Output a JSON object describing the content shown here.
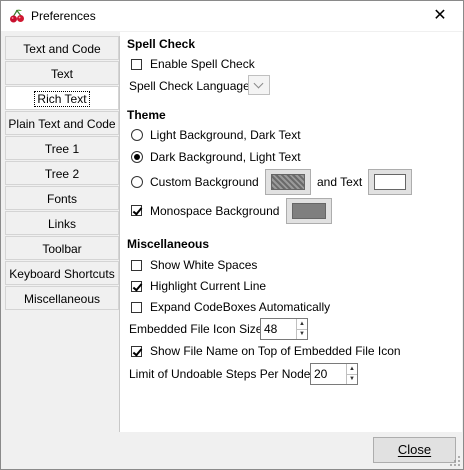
{
  "window": {
    "title": "Preferences",
    "close_glyph": "✕"
  },
  "sidebar": {
    "items": [
      {
        "label": "Text and Code"
      },
      {
        "label": "Text"
      },
      {
        "label": "Rich Text"
      },
      {
        "label": "Plain Text and Code"
      },
      {
        "label": "Tree 1"
      },
      {
        "label": "Tree 2"
      },
      {
        "label": "Fonts"
      },
      {
        "label": "Links"
      },
      {
        "label": "Toolbar"
      },
      {
        "label": "Keyboard Shortcuts"
      },
      {
        "label": "Miscellaneous"
      }
    ],
    "selected": "Rich Text"
  },
  "spell_check": {
    "heading": "Spell Check",
    "enable_label": "Enable Spell Check",
    "enable_checked": false,
    "language_label": "Spell Check Language",
    "language_value": ""
  },
  "theme": {
    "heading": "Theme",
    "light_label": "Light Background, Dark Text",
    "dark_label": "Dark Background, Light Text",
    "custom_label": "Custom Background",
    "and_text_label": "and Text",
    "selected": "dark",
    "monospace_label": "Monospace Background",
    "monospace_checked": true,
    "custom_bg_color": "#8a8a8a",
    "custom_text_color": "#ffffff",
    "monospace_color": "#7f7f7f"
  },
  "misc": {
    "heading": "Miscellaneous",
    "show_white_spaces": "Show White Spaces",
    "show_white_spaces_checked": false,
    "highlight_line": "Highlight Current Line",
    "highlight_line_checked": true,
    "expand_codeboxes": "Expand CodeBoxes Automatically",
    "expand_codeboxes_checked": false,
    "icon_size_label": "Embedded File Icon Size",
    "icon_size_value": "48",
    "show_filename": "Show File Name on Top of Embedded File Icon",
    "show_filename_checked": true,
    "undo_label": "Limit of Undoable Steps Per Node",
    "undo_value": "20"
  },
  "footer": {
    "close_label": "Close"
  }
}
